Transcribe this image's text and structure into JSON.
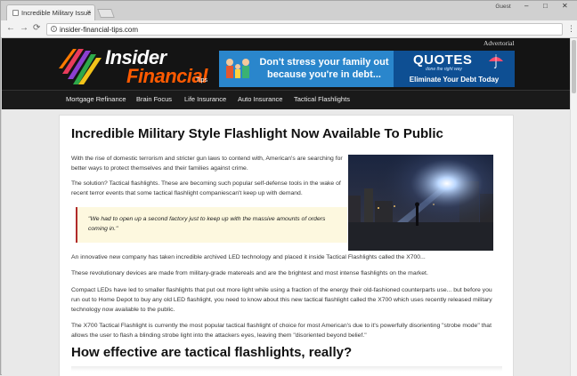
{
  "browser": {
    "tab_title": "Incredible Military Issue",
    "tab_close": "×",
    "profile": "Guest",
    "window_controls": {
      "minimize": "–",
      "maximize": "□",
      "close": "✕"
    },
    "nav": {
      "back": "←",
      "forward": "→",
      "reload": "⟳"
    },
    "url": "insider-financial-tips.com",
    "menu_icon": "⋮",
    "info_icon": "i"
  },
  "site": {
    "advertorial_label": "Advertorial",
    "logo": {
      "line1": "Insider",
      "line2": "Financial",
      "line3": "Tips"
    },
    "ad": {
      "headline_line1": "Don't stress your family out",
      "headline_line2": "because you're in debt...",
      "brand": "QUOTES",
      "tagline": "done the right way",
      "cta": "Eliminate Your Debt Today"
    },
    "nav_items": [
      "Mortgage Refinance",
      "Brain Focus",
      "Life Insurance",
      "Auto Insurance",
      "Tactical Flashlights"
    ]
  },
  "article": {
    "title": "Incredible Military Style Flashlight Now Available To Public",
    "p1": "With the rise of domestic terrorism and stricter gun laws to contend with, American's are searching for better ways to protect themselves and their families against crime.",
    "p2": "The solution? Tactical flashlights. These are becoming such popular self-defense tools in the wake of recent terror events that some tactical flashlight companiescan't keep up with demand.",
    "quote": "\"We had to open up a second factory just to keep up with the massive amounts of orders coming in.\"",
    "p3": "An innovative new company has taken incredible archived LED technology and placed it inside Tactical Flashlights called the X700...",
    "p4": "These revolutionary devices are made from military-grade matereals and are the brightest and most intense flashlights on the market.",
    "p5": "Compact LEDs have led to smaller flashlights that put out more light while using a fraction of the energy their old-fashioned counterparts use... but before you run out to Home Depot to buy any old LED flashlight, you need to know about this new tactical flashlight called the X700 which uses recently released military technology now available to the public.",
    "p6": "The X700 Tactical Flashlight is currently the most popular tactical flashlight of choice for most American's due to it's powerfully disorienting \"strobe mode\" that allows the user to flash a blinding strobe light into the attackers eyes, leaving them \"disoriented beyond belief.\"",
    "h2": "How effective are tactical flashlights, really?"
  },
  "colors": {
    "logo_orange": "#ff5a00",
    "ad_blue": "#2a86cc",
    "quote_bar": "#b02a2a",
    "quote_bg": "#fdf8df"
  }
}
